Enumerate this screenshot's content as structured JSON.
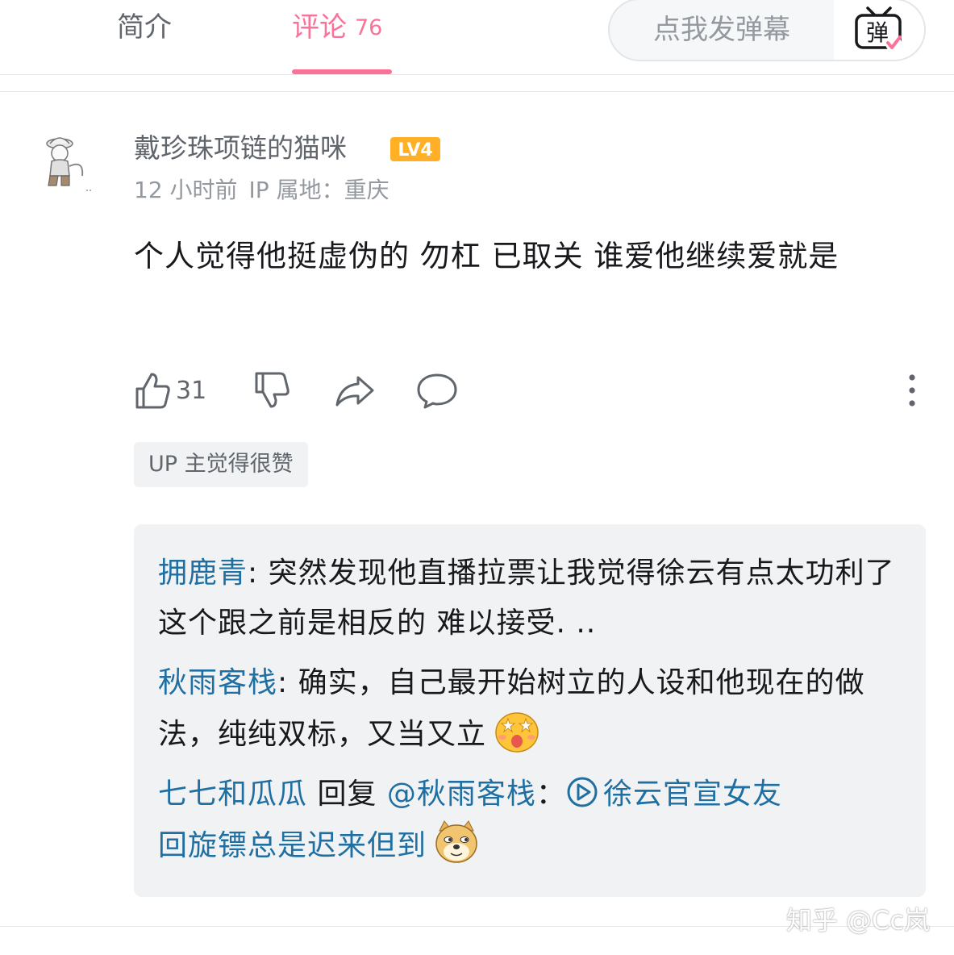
{
  "tabs": {
    "intro_label": "简介",
    "comments_label": "评论",
    "comments_count": "76"
  },
  "danmaku": {
    "placeholder": "点我发弹幕",
    "button_icon": "danmaku-toggle-icon",
    "button_glyph": "弹"
  },
  "comment": {
    "username": "戴珍珠项链的猫咪",
    "level": "LV4",
    "time": "12 小时前",
    "ip_location": "IP 属地：重庆",
    "text": "个人觉得他挺虚伪的 勿杠 已取关 谁爱他继续爱就是",
    "like_count": "31",
    "up_tag": "UP 主觉得很赞"
  },
  "replies": [
    {
      "name": "拥鹿青",
      "sep": ": ",
      "text": "突然发现他直播拉票让我觉得徐云有点太功利了 这个跟之前是相反的 难以接受. .."
    },
    {
      "name": "秋雨客栈",
      "sep": ": ",
      "text": "确实，自己最开始树立的人设和他现在的做法，纯纯双标，又当又立",
      "emoji": "starry-eyes-emoji"
    },
    {
      "name": "七七和瓜瓜",
      "reply_word": " 回复 ",
      "mention": "@秋雨客栈",
      "sep": "：",
      "link_text": "徐云官宣女友",
      "text": "回旋镖总是迟来但到",
      "emoji": "doge-emoji"
    }
  ],
  "watermark": "知乎 @Cc岚",
  "colors": {
    "accent_pink": "#fb7299",
    "link_blue": "#1f6fa3",
    "level_orange": "#ffb027"
  }
}
